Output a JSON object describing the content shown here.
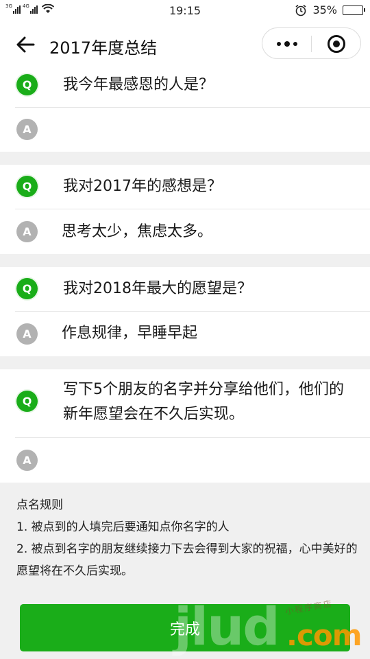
{
  "status_bar": {
    "net1": "3G",
    "net2": "4G",
    "time": "19:15",
    "battery_percent": "35%",
    "battery_level": 0.35
  },
  "nav": {
    "title": "2017年度总结"
  },
  "qa": [
    {
      "badge_q": "Q",
      "badge_a": "A",
      "question": "我今年最感恩的人是？",
      "answer": ""
    },
    {
      "badge_q": "Q",
      "badge_a": "A",
      "question": "我对2017年的感想是？",
      "answer": "思考太少，焦虑太多。"
    },
    {
      "badge_q": "Q",
      "badge_a": "A",
      "question": "我对2018年最大的愿望是？",
      "answer": "作息规律，早睡早起"
    },
    {
      "badge_q": "Q",
      "badge_a": "A",
      "question": "写下5个朋友的名字并分享给他们，他们的新年愿望会在不久后实现。",
      "answer": ""
    }
  ],
  "rules": {
    "title": "点名规则",
    "items": [
      "1. 被点到的人填完后要通知点你名字的人",
      "2. 被点到名字的朋友继续接力下去会得到大家的祝福，心中美好的愿望将在不久后实现。"
    ]
  },
  "done_button": {
    "label": "完成"
  },
  "watermark": {
    "main": "jlud",
    "domain": ".com",
    "sub": "小程序商店"
  },
  "colors": {
    "accent": "#1aad19",
    "answer_badge": "#b2b2b2",
    "background": "#f0f0f0"
  }
}
